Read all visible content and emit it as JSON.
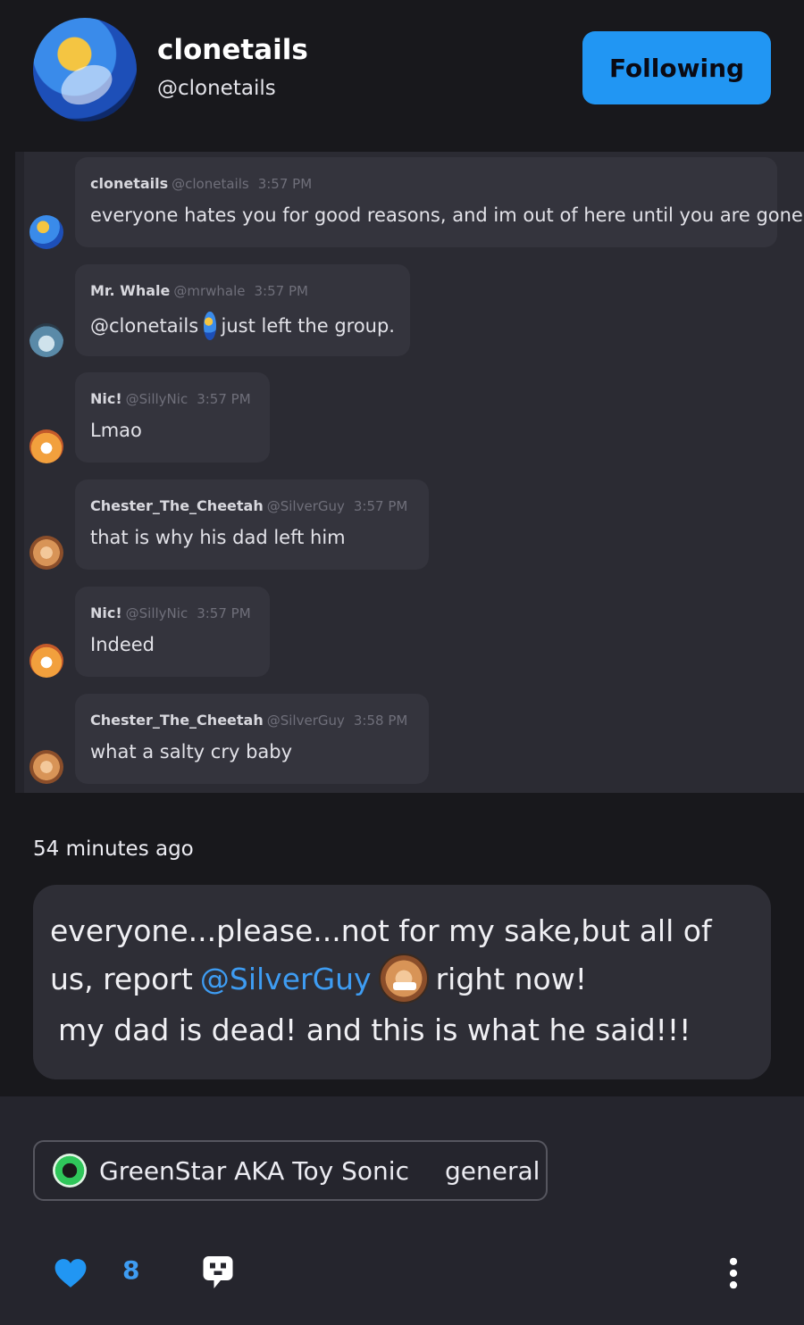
{
  "header": {
    "display_name": "clonetails",
    "handle": "@clonetails",
    "follow_label": "Following"
  },
  "chat": {
    "messages": [
      {
        "name": "clonetails",
        "username": "@clonetails",
        "time": "3:57 PM",
        "text": "everyone hates you for good reasons, and im out of here until you are gone!"
      },
      {
        "name": "Mr. Whale",
        "username": "@mrwhale",
        "time": "3:57 PM",
        "text_before": "@clonetails",
        "text_after": "just left the group."
      },
      {
        "name": "Nic!",
        "username": "@SillyNic",
        "time": "3:57 PM",
        "text": "Lmao"
      },
      {
        "name": "Chester_The_Cheetah",
        "username": "@SilverGuy",
        "time": "3:57 PM",
        "text": "that is why his dad left him"
      },
      {
        "name": "Nic!",
        "username": "@SillyNic",
        "time": "3:57 PM",
        "text": "Indeed"
      },
      {
        "name": "Chester_The_Cheetah",
        "username": "@SilverGuy",
        "time": "3:58 PM",
        "text": "what a salty cry baby"
      }
    ]
  },
  "post": {
    "time_ago": "54 minutes ago",
    "line1": "everyone...please...not for my sake,but all of",
    "line2_before": "us, report",
    "mention": "@SilverGuy",
    "line2_after": "right now!",
    "line3": "my dad is dead! and this is what he said!!!"
  },
  "footer": {
    "community_name": "GreenStar AKA Toy Sonic",
    "category": "general",
    "like_count": "8"
  },
  "icons": {
    "like": "heart-icon",
    "comment": "comment-icon",
    "more": "more-vertical-icon"
  },
  "colors": {
    "accent": "#2196f3",
    "mention": "#3e9cf2"
  }
}
